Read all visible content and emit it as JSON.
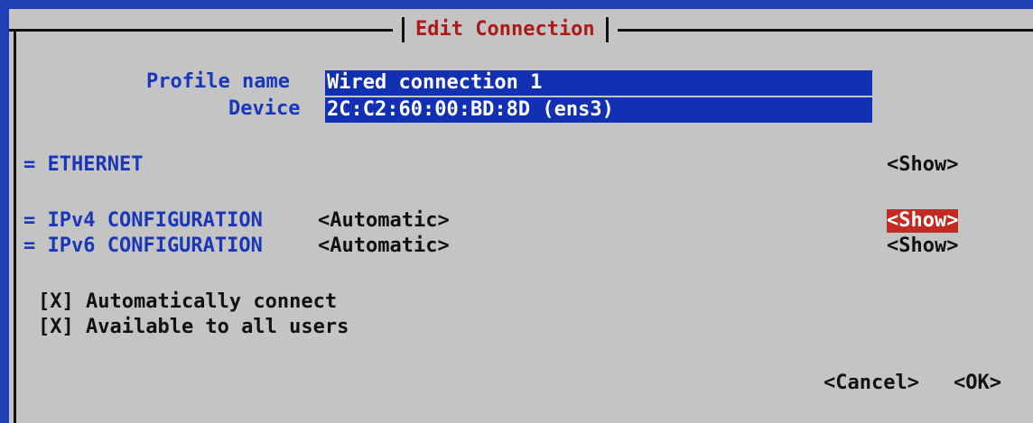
{
  "dialog": {
    "title": "Edit Connection"
  },
  "profile": {
    "name_label": "Profile name",
    "name_value": "Wired connection 1",
    "device_label": "Device",
    "device_value": "2C:C2:60:00:BD:8D (ens3)"
  },
  "sections": {
    "ethernet": {
      "label": "= ETHERNET",
      "show": "<Show>"
    },
    "ipv4": {
      "label": "= IPv4 CONFIGURATION",
      "mode": "<Automatic>",
      "show": "<Show>"
    },
    "ipv6": {
      "label": "= IPv6 CONFIGURATION",
      "mode": "<Automatic>",
      "show": "<Show>"
    }
  },
  "options": {
    "auto_connect": "[X] Automatically connect",
    "all_users": "[X] Available to all users"
  },
  "buttons": {
    "cancel": "<Cancel>",
    "ok": "<OK>"
  },
  "colors": {
    "screen_background": "#1f3fb5",
    "dialog_background": "#c4c4c4",
    "title_text": "#b01818",
    "label_text": "#1a37b8",
    "field_background": "#1230b2",
    "focused_button": "#c22a22"
  }
}
